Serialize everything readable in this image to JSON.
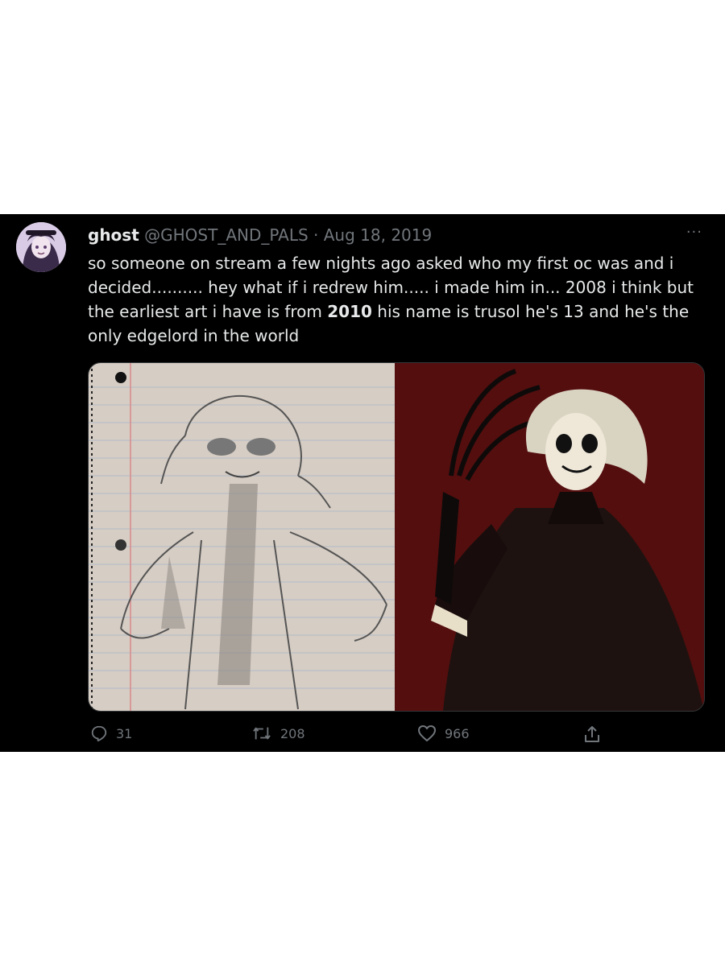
{
  "tweet": {
    "display_name": "ghost",
    "handle": "@GHOST_AND_PALS",
    "separator": "·",
    "date": "Aug 18, 2019",
    "more_label": "···",
    "text_parts": {
      "before_bold": "so someone on stream a few nights ago asked who my first oc was and i decided.......... hey what if i redrew him..... i made him in... 2008 i think but the earliest art i have is from ",
      "bold": "2010",
      "after_bold": " his name is trusol he's 13 and he's the only edgelord in the world"
    }
  },
  "actions": {
    "replies": "31",
    "retweets": "208",
    "likes": "966"
  },
  "icons": {
    "reply": "reply-icon",
    "retweet": "retweet-icon",
    "like": "heart-icon",
    "share": "share-icon",
    "more": "more-icon"
  },
  "colors": {
    "background": "#000000",
    "text": "#e7e9ea",
    "muted": "#71767b"
  }
}
